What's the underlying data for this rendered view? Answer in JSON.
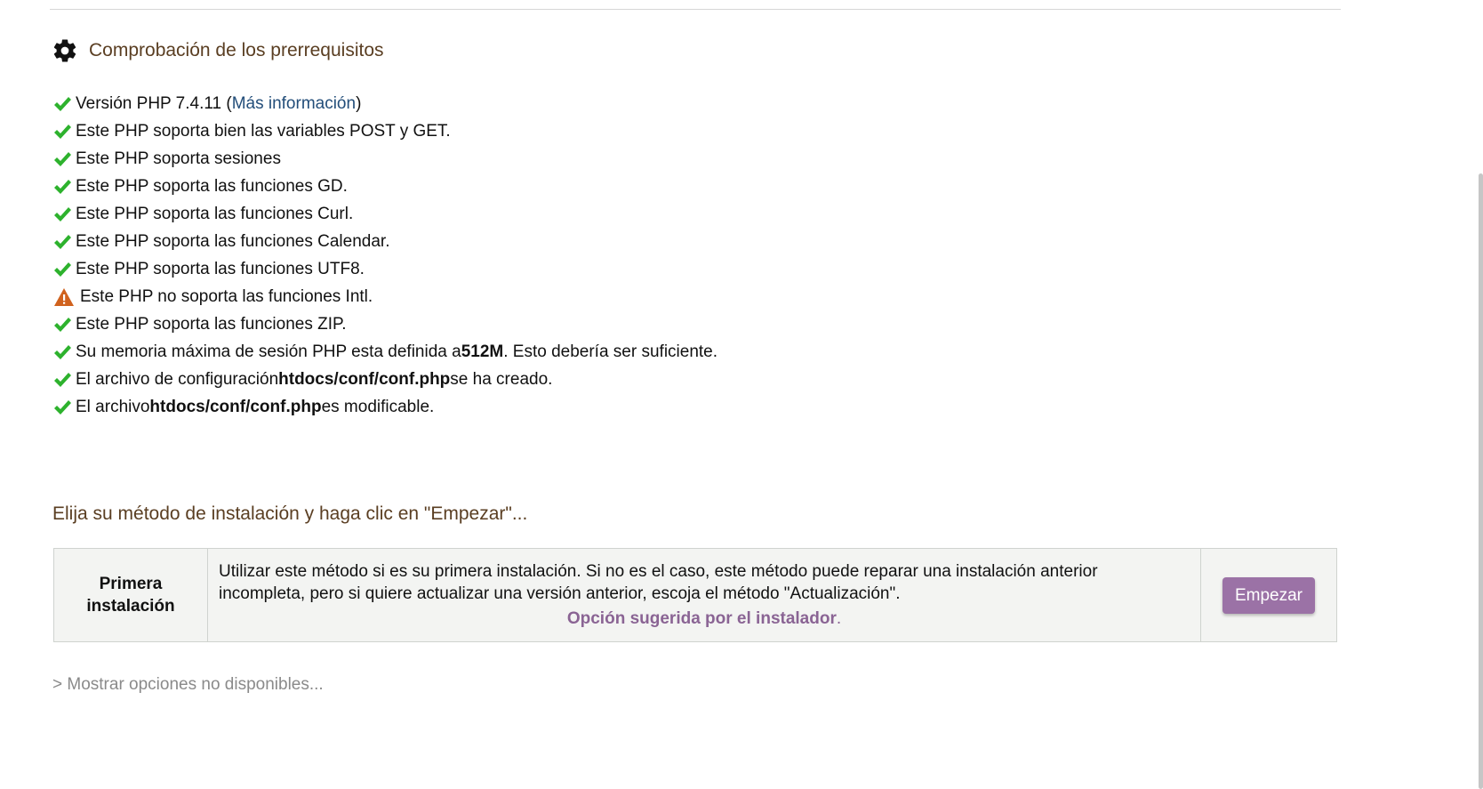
{
  "prereq": {
    "title": "Comprobación de los prerrequisitos",
    "icon": "gear-icon",
    "items": [
      {
        "status": "ok",
        "text_before": "Versión PHP 7.4.11 (",
        "link": "Más información",
        "text_after": ")"
      },
      {
        "status": "ok",
        "text": "Este PHP soporta bien las variables POST y GET."
      },
      {
        "status": "ok",
        "text": "Este PHP soporta sesiones"
      },
      {
        "status": "ok",
        "text": "Este PHP soporta las funciones GD."
      },
      {
        "status": "ok",
        "text": "Este PHP soporta las funciones Curl."
      },
      {
        "status": "ok",
        "text": "Este PHP soporta las funciones Calendar."
      },
      {
        "status": "ok",
        "text": "Este PHP soporta las funciones UTF8."
      },
      {
        "status": "warning",
        "text": "Este PHP no soporta las funciones Intl."
      },
      {
        "status": "ok",
        "text": "Este PHP soporta las funciones ZIP."
      },
      {
        "status": "ok",
        "text_before": "Su memoria máxima de sesión PHP esta definida a ",
        "bold": "512M",
        "text_after": ". Esto debería ser suficiente."
      },
      {
        "status": "ok",
        "text_before": "El archivo de configuración ",
        "bold": "htdocs/conf/conf.php",
        "text_after": " se ha creado."
      },
      {
        "status": "ok",
        "text_before": "El archivo ",
        "bold": "htdocs/conf/conf.php",
        "text_after": " es modificable."
      }
    ]
  },
  "install": {
    "title": "Elija su método de instalación y haga clic en \"Empezar\"...",
    "method": {
      "name_line1": "Primera",
      "name_line2": "instalación",
      "desc_line1": "Utilizar este método si es su primera instalación. Si no es el caso, este método puede reparar una instalación anterior",
      "desc_line2": "incompleta, pero si quiere actualizar una versión anterior, escoja el método \"Actualización\".",
      "suggested": "Opción sugerida por el instalador",
      "suggested_suffix": ".",
      "button": "Empezar"
    },
    "show_more": "> Mostrar opciones no disponibles..."
  },
  "colors": {
    "ok": "#2db22d",
    "warning": "#d0621e",
    "heading": "#5a3e22",
    "accent": "#9b72a6"
  }
}
